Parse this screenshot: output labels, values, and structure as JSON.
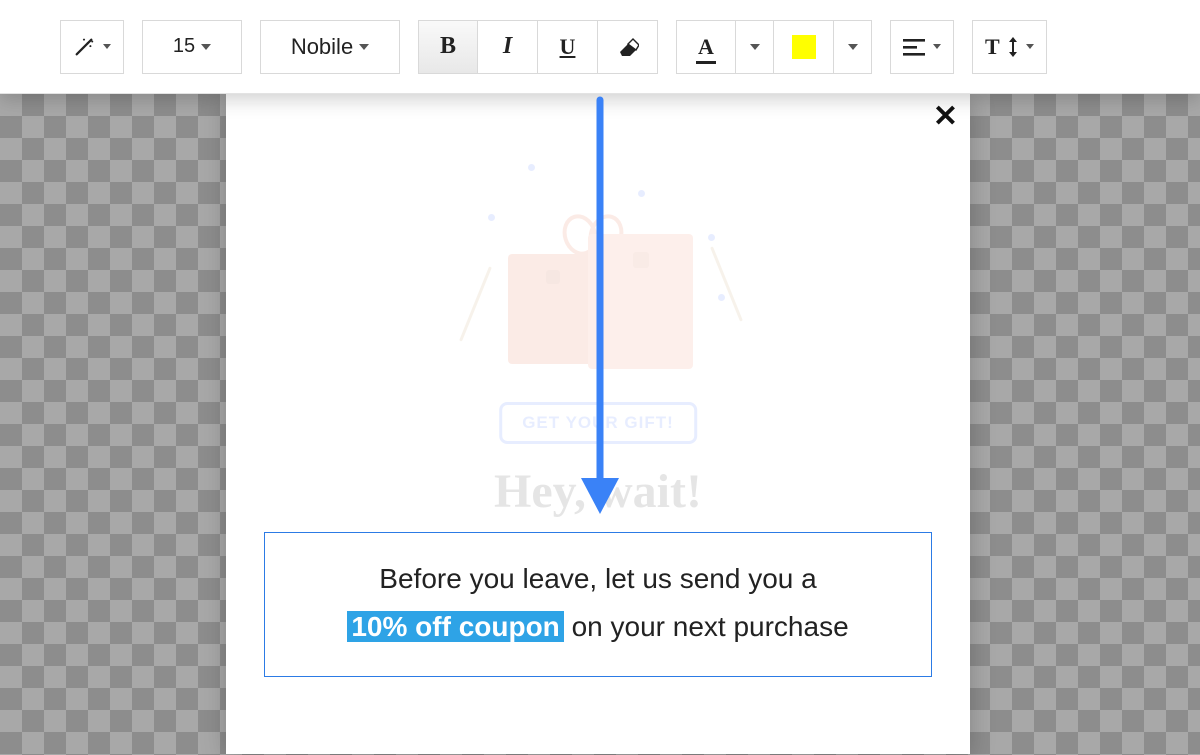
{
  "toolbar": {
    "font_size": "15",
    "font_family": "Nobile",
    "bold_glyph": "B",
    "italic_glyph": "I",
    "underline_glyph": "U",
    "font_color_glyph": "A",
    "highlight_color": "#ffff00",
    "line_height_glyph": "T"
  },
  "popup": {
    "close_glyph": "✕",
    "badge_text": "GET YOUR GIFT!",
    "heading": "Hey, wait!",
    "body_before": "Before you leave, let us send you a",
    "body_highlight": "10% off coupon",
    "body_after": " on your next purchase"
  }
}
